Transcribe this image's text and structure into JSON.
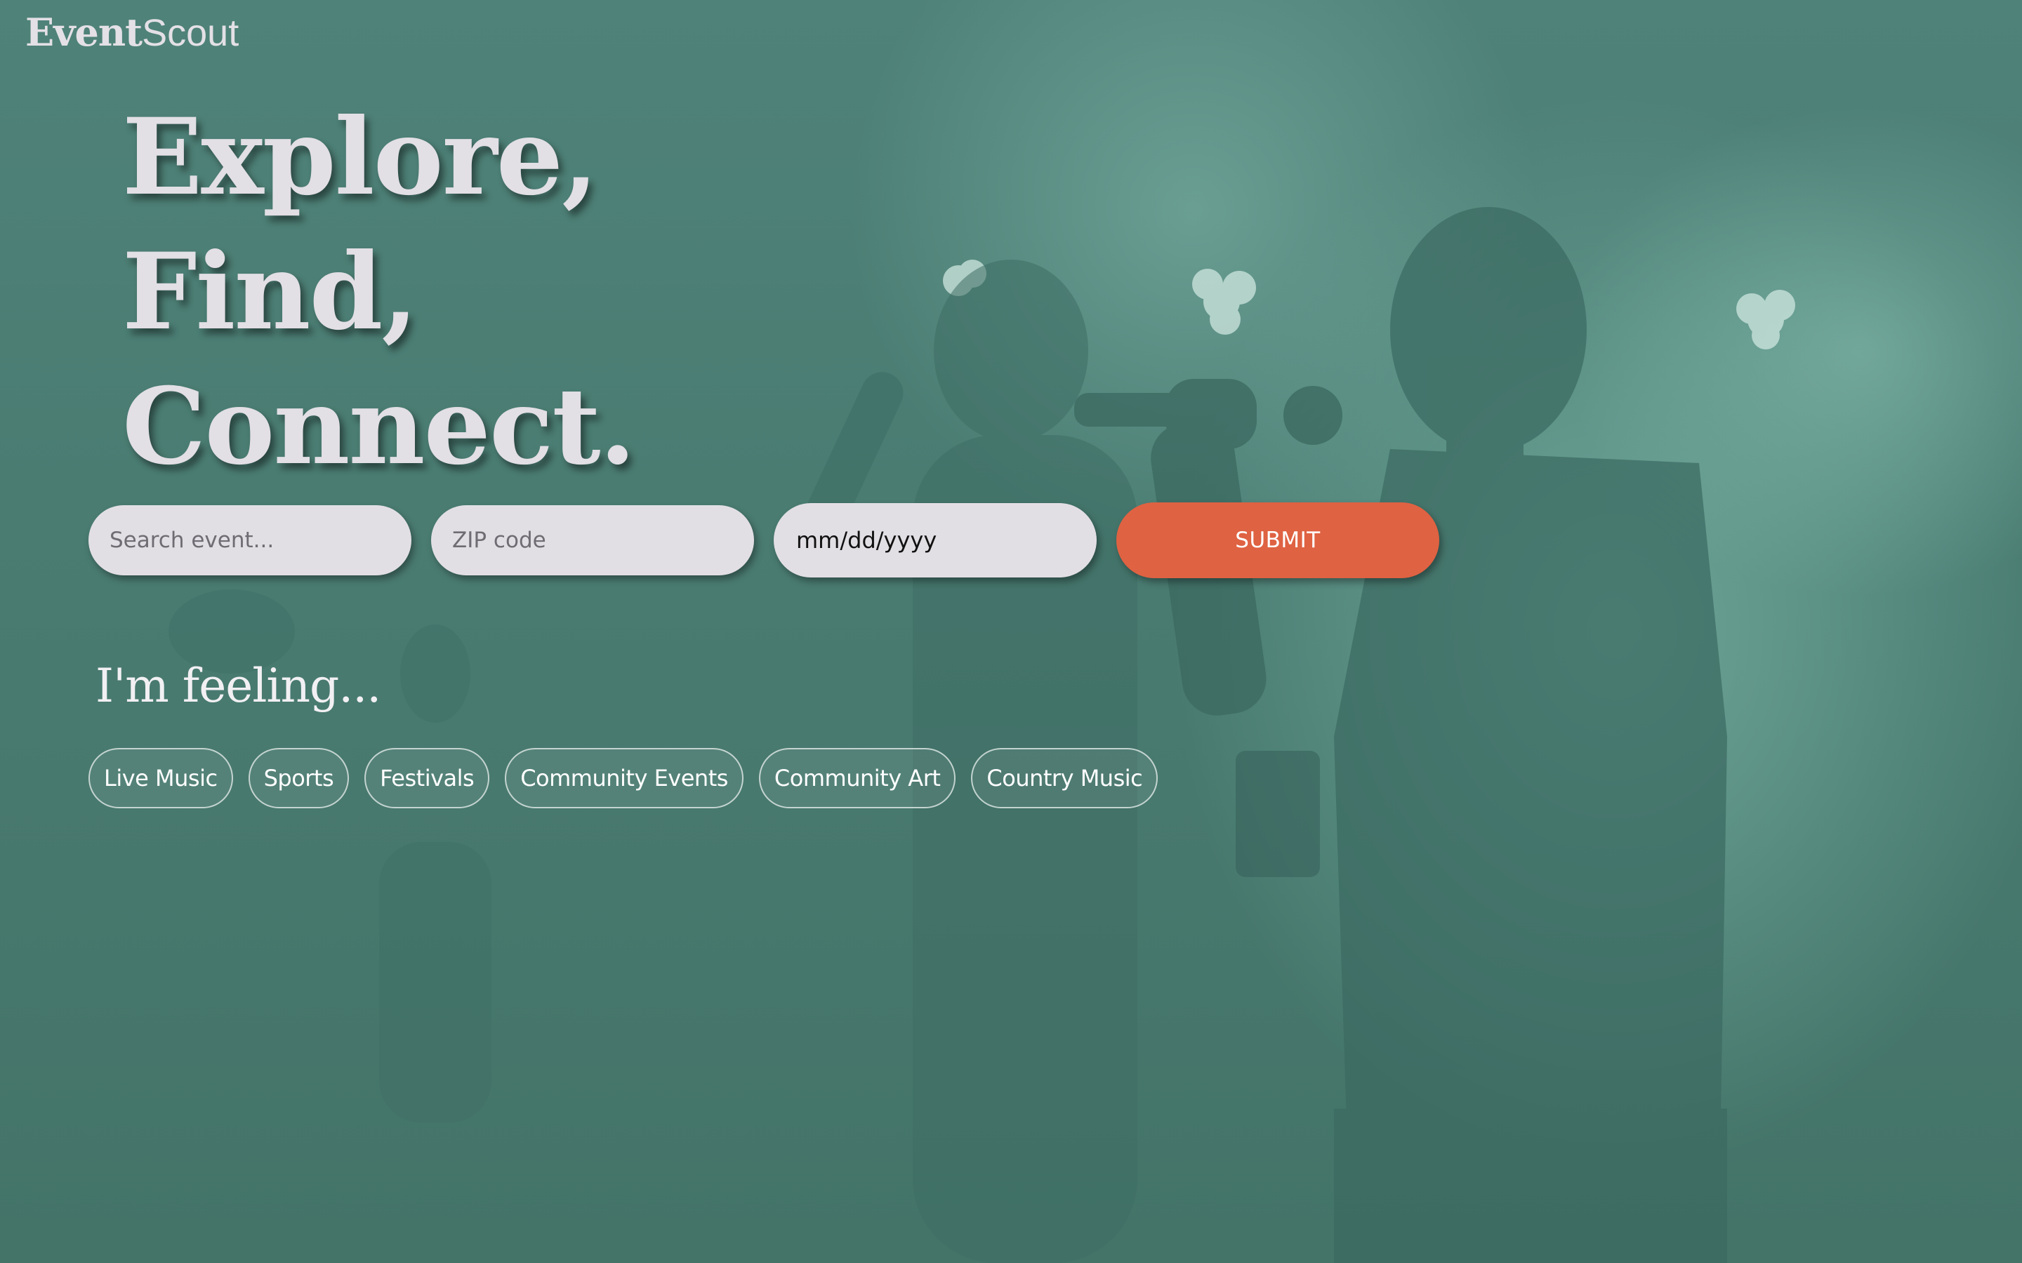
{
  "brand": {
    "name_bold": "Event",
    "name_light": "Scout"
  },
  "hero": {
    "lines": [
      "Explore,",
      "Find,",
      "Connect."
    ]
  },
  "search": {
    "event_placeholder": "Search event...",
    "zip_placeholder": "ZIP code",
    "date_placeholder": "mm/dd/yyyy",
    "submit_label": "SUBMIT"
  },
  "feeling": {
    "title": "I'm feeling...",
    "chips": [
      "Live Music",
      "Sports",
      "Festivals",
      "Community Events",
      "Community Art",
      "Country Music"
    ]
  },
  "colors": {
    "background_tint": "#497a70",
    "submit": "#df6242",
    "input": "#e2dfe4",
    "hero_text": "#e2dfe5"
  },
  "background": {
    "image_subject": "performers-with-microphones-on-stage"
  }
}
